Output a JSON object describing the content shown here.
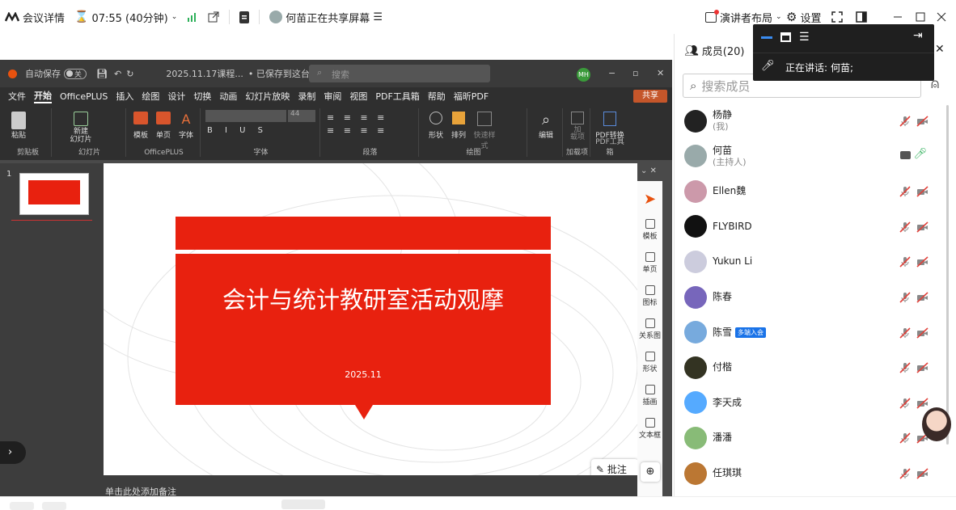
{
  "topbar": {
    "meeting_details": "会议详情",
    "timer": "07:55 (40分钟)",
    "sharing_status": "何苗正在共享屏幕",
    "presenter_layout": "演讲者布局",
    "settings": "设置"
  },
  "ppt": {
    "autosave": "自动保存",
    "autosave_state": "关",
    "doc_title": "2025.11.17课程...",
    "saved_state": "• 已保存到这台电脑",
    "search_placeholder": "搜索",
    "user_initials": "MH",
    "menu": [
      "文件",
      "开始",
      "OfficePLUS",
      "插入",
      "绘图",
      "设计",
      "切换",
      "动画",
      "幻灯片放映",
      "录制",
      "审阅",
      "视图",
      "PDF工具箱",
      "帮助",
      "福昕PDF"
    ],
    "share_btn": "共享",
    "ribbon": {
      "paste": "粘贴",
      "clipboard": "剪贴板",
      "new_slide": "新建\n幻灯片",
      "slides": "幻灯片",
      "template": "模板",
      "single_page": "单页",
      "font_btn": "字体",
      "officeplus": "OfficePLUS",
      "font_group": "字体",
      "font_size": "44",
      "paragraph": "段落",
      "shape": "形状",
      "arrange": "排列",
      "quick_style": "快速样式",
      "drawing": "绘图",
      "edit": "编辑",
      "addin": "加\n载项",
      "addin_group": "加载项",
      "pdf_convert": "PDF转换",
      "pdf_tools": "PDF工具箱"
    },
    "slide_number": "1",
    "slide_title": "会计与统计教研室活动观摩",
    "slide_date": "2025.11",
    "notes_hint": "单击此处添加备注",
    "annotate": "批注",
    "side_pane": [
      "模板",
      "单页",
      "图标",
      "关系图",
      "形状",
      "插画",
      "文本框"
    ]
  },
  "floating": {
    "speaking_label": "正在讲话:",
    "speaker": "何苗;"
  },
  "panel": {
    "members_title": "成员(20)",
    "search_placeholder": "搜索成员",
    "members": [
      {
        "name": "杨静",
        "sub": "(我)",
        "color": "#222"
      },
      {
        "name": "何苗",
        "sub": "(主持人)",
        "color": "#9aa"
      },
      {
        "name": "Ellen魏",
        "sub": "",
        "color": "#c9a"
      },
      {
        "name": "FLYBIRD",
        "sub": "",
        "color": "#111"
      },
      {
        "name": "Yukun Li",
        "sub": "",
        "color": "#ccd"
      },
      {
        "name": "陈春",
        "sub": "",
        "color": "#76b"
      },
      {
        "name": "陈雪",
        "sub": "",
        "badge": "多端入会",
        "color": "#7ad"
      },
      {
        "name": "付楷",
        "sub": "",
        "color": "#332"
      },
      {
        "name": "李天成",
        "sub": "",
        "color": "#5af"
      },
      {
        "name": "潘潘",
        "sub": "",
        "color": "#8b7"
      },
      {
        "name": "任琪琪",
        "sub": "",
        "color": "#b73"
      }
    ]
  },
  "colors": {
    "accent": "#1a73e8",
    "slide_red": "#e8210f",
    "mute_red": "#e0413a",
    "mic_green": "#2eb05a"
  }
}
